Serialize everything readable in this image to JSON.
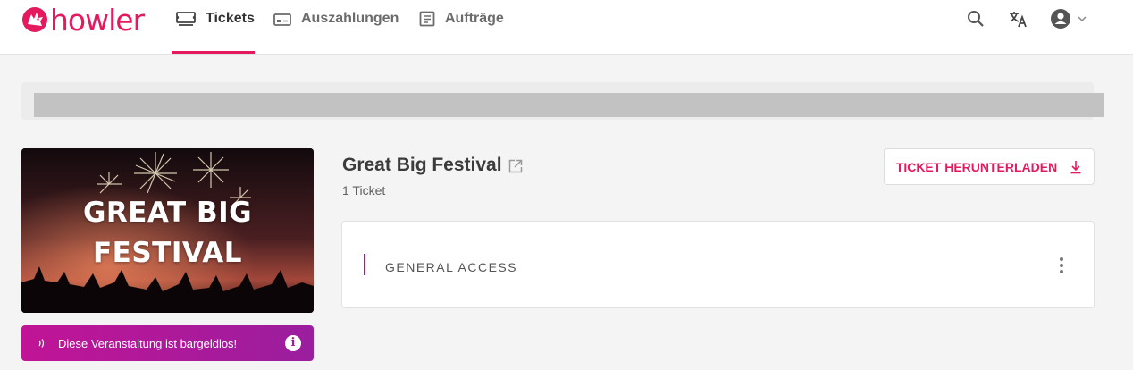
{
  "brand": {
    "name": "howler",
    "color": "#e5195e"
  },
  "nav": {
    "tabs": [
      {
        "label": "Tickets",
        "icon": "ticket-icon",
        "active": true
      },
      {
        "label": "Auszahlungen",
        "icon": "payout-icon",
        "active": false
      },
      {
        "label": "Aufträge",
        "icon": "orders-icon",
        "active": false
      }
    ],
    "actions": [
      "search-icon",
      "translate-icon",
      "account-icon"
    ]
  },
  "event": {
    "title": "Great Big Festival",
    "ticket_count": "1 Ticket",
    "image_text_line1": "GREAT BIG",
    "image_text_line2": "FESTIVAL"
  },
  "cashless": {
    "text": "Diese Veranstaltung ist bargeldlos!",
    "info": "i",
    "color_from": "#c11496",
    "color_to": "#9a1e9e"
  },
  "download": {
    "label": "TICKET HERUNTERLADEN"
  },
  "ticket": {
    "type": "GENERAL ACCESS",
    "accent_color": "#a0189c"
  }
}
